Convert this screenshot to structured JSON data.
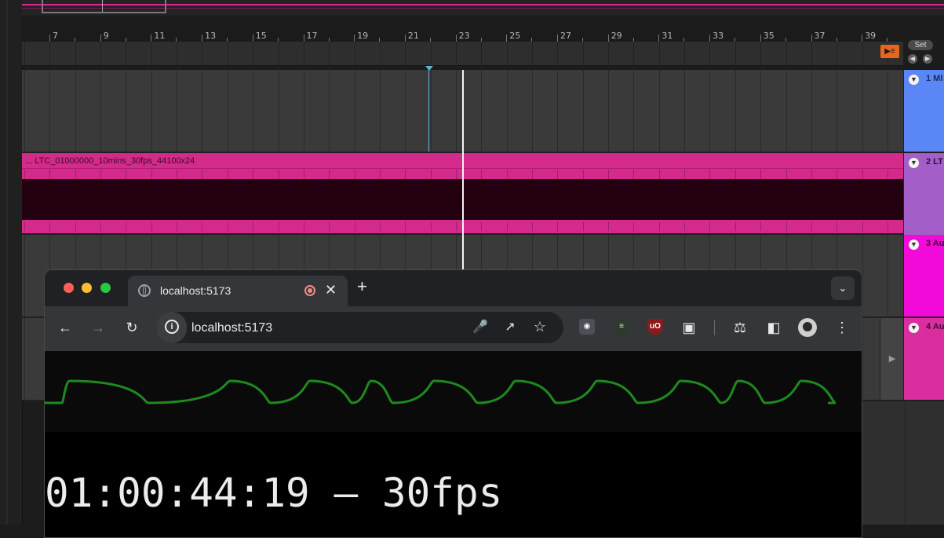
{
  "daw": {
    "ruler_labels": [
      "7",
      "9",
      "11",
      "13",
      "15",
      "17",
      "19",
      "21",
      "23",
      "25",
      "27",
      "29",
      "31",
      "33",
      "35",
      "37",
      "39"
    ],
    "set_label": "Set",
    "clip_name": "... LTC_01000000_10mins_30fps_44100x24",
    "tracks": [
      {
        "name": "1 MI",
        "color": "#5b86f5"
      },
      {
        "name": "2 LT",
        "color": "#a45ec7"
      },
      {
        "name": "3 Au",
        "color": "#f10ad8"
      },
      {
        "name": "4 Au",
        "color": "#da2ea0"
      }
    ],
    "colors": {
      "clip": "#d42a8c",
      "loop_button": "#e8661c",
      "cue_marker": "#58b8d0"
    }
  },
  "browser": {
    "tab_title": "localhost:5173",
    "url": "localhost:5173",
    "waveform_color": "#1e8a1e",
    "timecode_text": "01:00:44:19 – 30fps",
    "icons": [
      "back-arrow-icon",
      "forward-arrow-icon",
      "reload-icon",
      "site-info-icon",
      "microphone-icon",
      "open-in-app-icon",
      "bookmark-star-icon",
      "spy-extension-icon",
      "mixer-extension-icon",
      "ublock-extension-icon",
      "extensions-puzzle-icon",
      "labs-flask-icon",
      "side-panel-icon",
      "profile-avatar",
      "menu-kebab-icon"
    ]
  }
}
